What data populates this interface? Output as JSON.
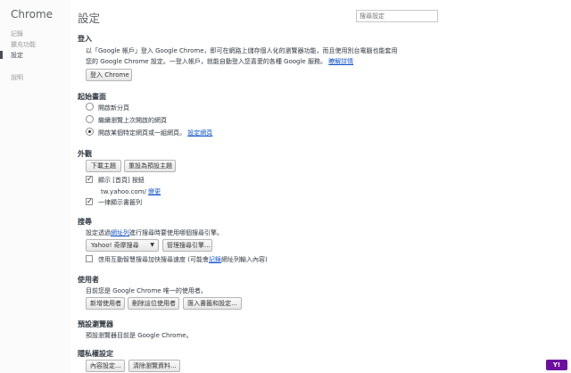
{
  "sidebar": {
    "brand": "Chrome",
    "items": [
      {
        "label": "記錄"
      },
      {
        "label": "擴充功能"
      },
      {
        "label": "設定"
      },
      {
        "label": "說明"
      }
    ]
  },
  "header": {
    "title": "設定",
    "search_placeholder": "搜尋設定"
  },
  "signin": {
    "heading": "登入",
    "line1": "以「Google 帳戶」登入 Google Chrome，即可在網路上儲存個人化的瀏覽器功能，而且使用別台電腦也能套用",
    "line2": "您的 Google Chrome 設定。一登入帳戶，就能自動登入您喜愛的各種 Google 服務。",
    "learn_more": "瞭解詳情",
    "button": "登入 Chrome"
  },
  "startup": {
    "heading": "起始畫面",
    "options": [
      {
        "label": "開啟新分頁",
        "selected": false
      },
      {
        "label": "繼續瀏覽上次開啟的網頁",
        "selected": false
      },
      {
        "label": "開啟某個特定網頁或一組網頁。",
        "selected": true
      }
    ],
    "set_pages_link": "設定網頁"
  },
  "appearance": {
    "heading": "外觀",
    "get_themes": "下載主題",
    "reset_theme": "重設為預設主題",
    "show_home_label": "顯示 [首頁] 按鈕",
    "show_home_checked": true,
    "home_url": "tw.yahoo.com/",
    "change_link": "變更",
    "bookmarks_bar_label": "一律顯示書籤列",
    "bookmarks_bar_checked": true
  },
  "search": {
    "heading": "搜尋",
    "desc_prefix": "設定透過",
    "desc_link": "網址列",
    "desc_suffix": "進行搜尋時要使用哪個搜尋引擎。",
    "engine_selected": "Yahoo! 奇摩搜尋",
    "manage_button": "管理搜尋引擎...",
    "instant_prefix": "啓用互動智慧搜尋加快搜尋速度 (可能會",
    "instant_link": "記錄",
    "instant_suffix": "網址列輸入內容)",
    "instant_checked": false
  },
  "users": {
    "heading": "使用者",
    "desc": "目前您是 Google Chrome 唯一的使用者。",
    "add_button": "新增使用者",
    "delete_button": "刪除這位使用者",
    "import_button": "匯入書籤和設定..."
  },
  "default_browser": {
    "heading": "預設瀏覽器",
    "desc": "預設瀏覽器目前是 Google Chrome。"
  },
  "privacy": {
    "heading": "隱私權設定",
    "content_button": "內容設定...",
    "clear_button": "清除瀏覽資料..."
  },
  "watermark": {
    "label": "Y!"
  },
  "colors": {
    "link": "#1155cc",
    "badge": "#6c0f9f"
  }
}
